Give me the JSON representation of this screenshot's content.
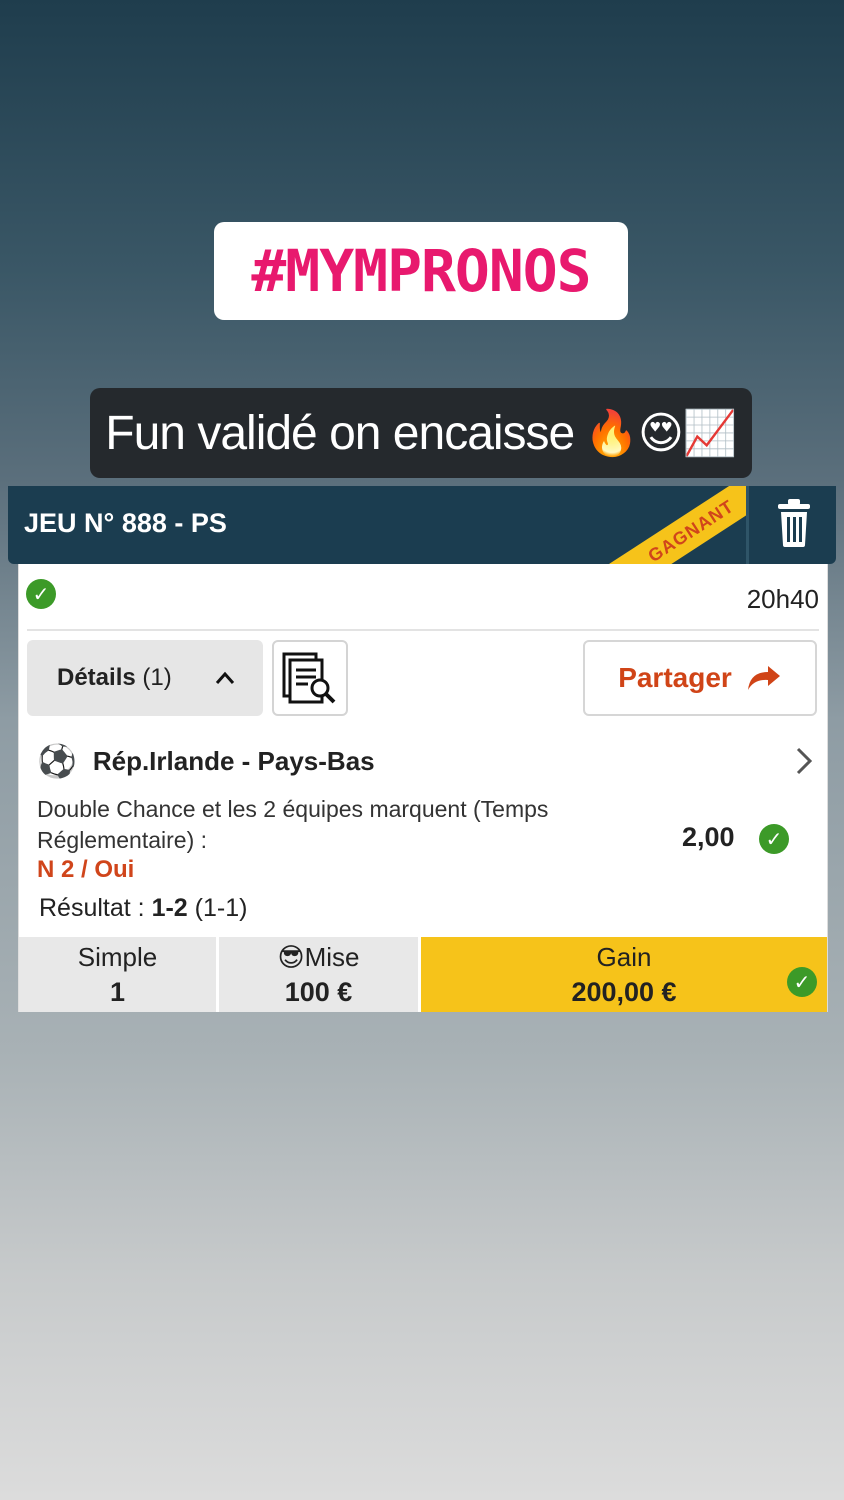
{
  "story": {
    "hashtag": "#MYMPRONOS",
    "caption": "Fun validé on encaisse",
    "caption_emojis": "🔥😍📈",
    "hashtag_color": "#e8196e"
  },
  "bet": {
    "title": "JEU N° 888 - PS",
    "status_ribbon": "GAGNANT",
    "time": "20h40",
    "details_label": "Détails",
    "details_count": "(1)",
    "share_label": "Partager",
    "match": "Rép.Irlande - Pays-Bas",
    "market": "Double Chance et les 2 équipes marquent (Temps Réglementaire) :",
    "selection": "N 2 / Oui",
    "odds": "2,00",
    "result_label": "Résultat :",
    "result_score": "1-2",
    "result_halftime": "(1-1)",
    "footer": {
      "type_label": "Simple",
      "type_value": "1",
      "stake_label": "😎Mise",
      "stake_value": "100 €",
      "gain_label": "Gain",
      "gain_value": "200,00 €"
    },
    "colors": {
      "header": "#1b3d50",
      "accent": "#d0451b",
      "win_yellow": "#f6c31a",
      "check_green": "#3c9a28"
    }
  }
}
